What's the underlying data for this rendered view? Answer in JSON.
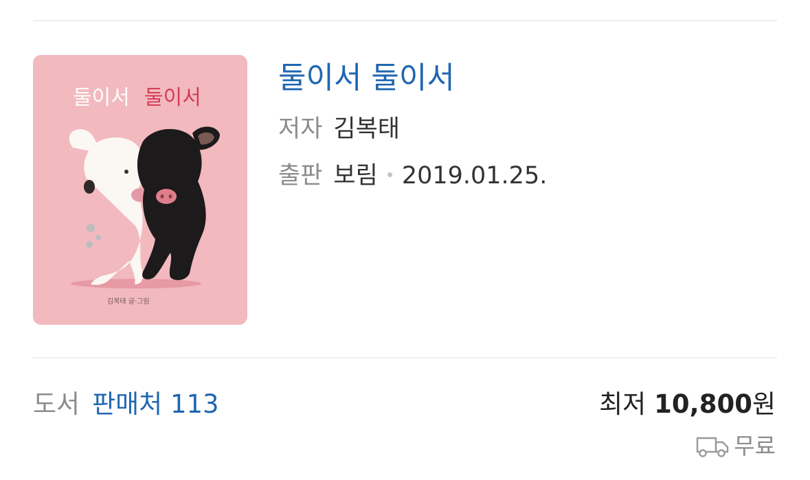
{
  "book": {
    "title": "둘이서 둘이서",
    "author_key": "저자",
    "author": "김복태",
    "publisher_key": "출판",
    "publisher": "보림",
    "date": "2019.01.25."
  },
  "cover": {
    "title_part1": "둘이서",
    "title_part2": "둘이서",
    "credit": "김복태 글·그림",
    "background": "#f2b9bf",
    "accent": "#d23c55"
  },
  "listing": {
    "category": "도서",
    "sellers": "판매처 113",
    "price_label": "최저",
    "price_value": "10,800",
    "price_unit": "원",
    "shipping": "무료"
  },
  "colors": {
    "link": "#1f66b1",
    "muted": "#8c8c8c",
    "divider": "#eeeeee"
  },
  "icons": {
    "shipping": "truck-icon"
  }
}
